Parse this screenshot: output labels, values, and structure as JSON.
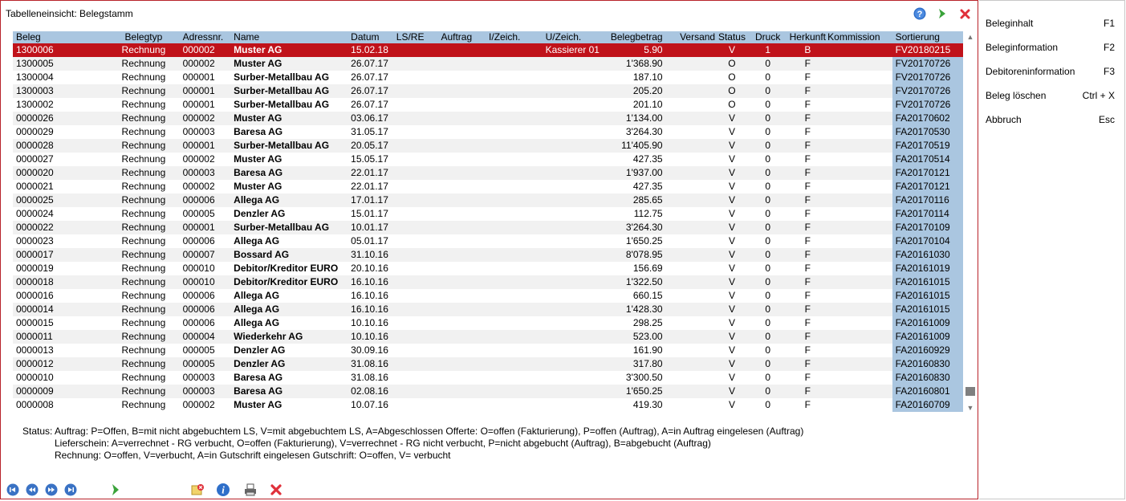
{
  "window": {
    "title": "Tabelleneinsicht: Belegstamm"
  },
  "columns": [
    "Beleg",
    "Belegtyp",
    "Adressnr.",
    "Name",
    "Datum",
    "LS/RE",
    "Auftrag",
    "I/Zeich.",
    "U/Zeich.",
    "Belegbetrag",
    "Versand",
    "Status",
    "Druck",
    "Herkunft",
    "Kommission",
    "Sortierung"
  ],
  "rows": [
    [
      "1300006",
      "Rechnung",
      "000002",
      "Muster AG",
      "15.02.18",
      "",
      "",
      "",
      "Kassierer 01",
      "5.90",
      "",
      "V",
      "1",
      "B",
      "",
      "FV20180215"
    ],
    [
      "1300005",
      "Rechnung",
      "000002",
      "Muster AG",
      "26.07.17",
      "",
      "",
      "",
      "",
      "1'368.90",
      "",
      "O",
      "0",
      "F",
      "",
      "FV20170726"
    ],
    [
      "1300004",
      "Rechnung",
      "000001",
      "Surber-Metallbau AG",
      "26.07.17",
      "",
      "",
      "",
      "",
      "187.10",
      "",
      "O",
      "0",
      "F",
      "",
      "FV20170726"
    ],
    [
      "1300003",
      "Rechnung",
      "000001",
      "Surber-Metallbau AG",
      "26.07.17",
      "",
      "",
      "",
      "",
      "205.20",
      "",
      "O",
      "0",
      "F",
      "",
      "FV20170726"
    ],
    [
      "1300002",
      "Rechnung",
      "000001",
      "Surber-Metallbau AG",
      "26.07.17",
      "",
      "",
      "",
      "",
      "201.10",
      "",
      "O",
      "0",
      "F",
      "",
      "FV20170726"
    ],
    [
      "0000026",
      "Rechnung",
      "000002",
      "Muster AG",
      "03.06.17",
      "",
      "",
      "",
      "",
      "1'134.00",
      "",
      "V",
      "0",
      "F",
      "",
      "FA20170602"
    ],
    [
      "0000029",
      "Rechnung",
      "000003",
      "Baresa  AG",
      "31.05.17",
      "",
      "",
      "",
      "",
      "3'264.30",
      "",
      "V",
      "0",
      "F",
      "",
      "FA20170530"
    ],
    [
      "0000028",
      "Rechnung",
      "000001",
      "Surber-Metallbau AG",
      "20.05.17",
      "",
      "",
      "",
      "",
      "11'405.90",
      "",
      "V",
      "0",
      "F",
      "",
      "FA20170519"
    ],
    [
      "0000027",
      "Rechnung",
      "000002",
      "Muster AG",
      "15.05.17",
      "",
      "",
      "",
      "",
      "427.35",
      "",
      "V",
      "0",
      "F",
      "",
      "FA20170514"
    ],
    [
      "0000020",
      "Rechnung",
      "000003",
      "Baresa  AG",
      "22.01.17",
      "",
      "",
      "",
      "",
      "1'937.00",
      "",
      "V",
      "0",
      "F",
      "",
      "FA20170121"
    ],
    [
      "0000021",
      "Rechnung",
      "000002",
      "Muster AG",
      "22.01.17",
      "",
      "",
      "",
      "",
      "427.35",
      "",
      "V",
      "0",
      "F",
      "",
      "FA20170121"
    ],
    [
      "0000025",
      "Rechnung",
      "000006",
      "Allega AG",
      "17.01.17",
      "",
      "",
      "",
      "",
      "285.65",
      "",
      "V",
      "0",
      "F",
      "",
      "FA20170116"
    ],
    [
      "0000024",
      "Rechnung",
      "000005",
      "Denzler AG",
      "15.01.17",
      "",
      "",
      "",
      "",
      "112.75",
      "",
      "V",
      "0",
      "F",
      "",
      "FA20170114"
    ],
    [
      "0000022",
      "Rechnung",
      "000001",
      "Surber-Metallbau AG",
      "10.01.17",
      "",
      "",
      "",
      "",
      "3'264.30",
      "",
      "V",
      "0",
      "F",
      "",
      "FA20170109"
    ],
    [
      "0000023",
      "Rechnung",
      "000006",
      "Allega AG",
      "05.01.17",
      "",
      "",
      "",
      "",
      "1'650.25",
      "",
      "V",
      "0",
      "F",
      "",
      "FA20170104"
    ],
    [
      "0000017",
      "Rechnung",
      "000007",
      "Bossard AG",
      "31.10.16",
      "",
      "",
      "",
      "",
      "8'078.95",
      "",
      "V",
      "0",
      "F",
      "",
      "FA20161030"
    ],
    [
      "0000019",
      "Rechnung",
      "000010",
      "Debitor/Kreditor EURO",
      "20.10.16",
      "",
      "",
      "",
      "",
      "156.69",
      "",
      "V",
      "0",
      "F",
      "",
      "FA20161019"
    ],
    [
      "0000018",
      "Rechnung",
      "000010",
      "Debitor/Kreditor EURO",
      "16.10.16",
      "",
      "",
      "",
      "",
      "1'322.50",
      "",
      "V",
      "0",
      "F",
      "",
      "FA20161015"
    ],
    [
      "0000016",
      "Rechnung",
      "000006",
      "Allega AG",
      "16.10.16",
      "",
      "",
      "",
      "",
      "660.15",
      "",
      "V",
      "0",
      "F",
      "",
      "FA20161015"
    ],
    [
      "0000014",
      "Rechnung",
      "000006",
      "Allega AG",
      "16.10.16",
      "",
      "",
      "",
      "",
      "1'428.30",
      "",
      "V",
      "0",
      "F",
      "",
      "FA20161015"
    ],
    [
      "0000015",
      "Rechnung",
      "000006",
      "Allega AG",
      "10.10.16",
      "",
      "",
      "",
      "",
      "298.25",
      "",
      "V",
      "0",
      "F",
      "",
      "FA20161009"
    ],
    [
      "0000011",
      "Rechnung",
      "000004",
      "Wiederkehr AG",
      "10.10.16",
      "",
      "",
      "",
      "",
      "523.00",
      "",
      "V",
      "0",
      "F",
      "",
      "FA20161009"
    ],
    [
      "0000013",
      "Rechnung",
      "000005",
      "Denzler AG",
      "30.09.16",
      "",
      "",
      "",
      "",
      "161.90",
      "",
      "V",
      "0",
      "F",
      "",
      "FA20160929"
    ],
    [
      "0000012",
      "Rechnung",
      "000005",
      "Denzler AG",
      "31.08.16",
      "",
      "",
      "",
      "",
      "317.80",
      "",
      "V",
      "0",
      "F",
      "",
      "FA20160830"
    ],
    [
      "0000010",
      "Rechnung",
      "000003",
      "Baresa  AG",
      "31.08.16",
      "",
      "",
      "",
      "",
      "3'300.50",
      "",
      "V",
      "0",
      "F",
      "",
      "FA20160830"
    ],
    [
      "0000009",
      "Rechnung",
      "000003",
      "Baresa  AG",
      "02.08.16",
      "",
      "",
      "",
      "",
      "1'650.25",
      "",
      "V",
      "0",
      "F",
      "",
      "FA20160801"
    ],
    [
      "0000008",
      "Rechnung",
      "000002",
      "Muster AG",
      "10.07.16",
      "",
      "",
      "",
      "",
      "419.30",
      "",
      "V",
      "0",
      "F",
      "",
      "FA20160709"
    ]
  ],
  "legend": {
    "line1": "Status: Auftrag: P=Offen, B=mit nicht abgebuchtem LS, V=mit abgebuchtem LS, A=Abgeschlossen   Offerte: O=offen (Fakturierung), P=offen (Auftrag), A=in Auftrag eingelesen (Auftrag)",
    "line2": "Lieferschein: A=verrechnet - RG verbucht, O=offen (Fakturierung), V=verrechnet - RG nicht verbucht, P=nicht abgebucht (Auftrag), B=abgebucht (Auftrag)",
    "line3": "Rechnung: O=offen, V=verbucht, A=in Gutschrift eingelesen     Gutschrift: O=offen, V= verbucht"
  },
  "side_menu": [
    {
      "label": "Beleginhalt",
      "shortcut": "F1"
    },
    {
      "label": "Beleginformation",
      "shortcut": "F2"
    },
    {
      "label": "Debitoreninformation",
      "shortcut": "F3"
    },
    {
      "label": "Beleg löschen",
      "shortcut": "Ctrl + X"
    },
    {
      "label": "Abbruch",
      "shortcut": "Esc"
    }
  ],
  "icons": {
    "top": [
      "help-icon",
      "forward-arrow-icon",
      "close-icon"
    ],
    "bottom": [
      "first-record-icon",
      "previous-record-icon",
      "next-record-icon",
      "last-record-icon",
      "execute-arrow-icon",
      "delete-document-icon",
      "info-icon",
      "print-icon",
      "cancel-icon"
    ]
  },
  "colors": {
    "accent_red": "#c0121a",
    "header_blue": "#aac6e0",
    "nav_blue": "#3a72c4",
    "green": "#3aa33a"
  },
  "selected_row_index": 0
}
